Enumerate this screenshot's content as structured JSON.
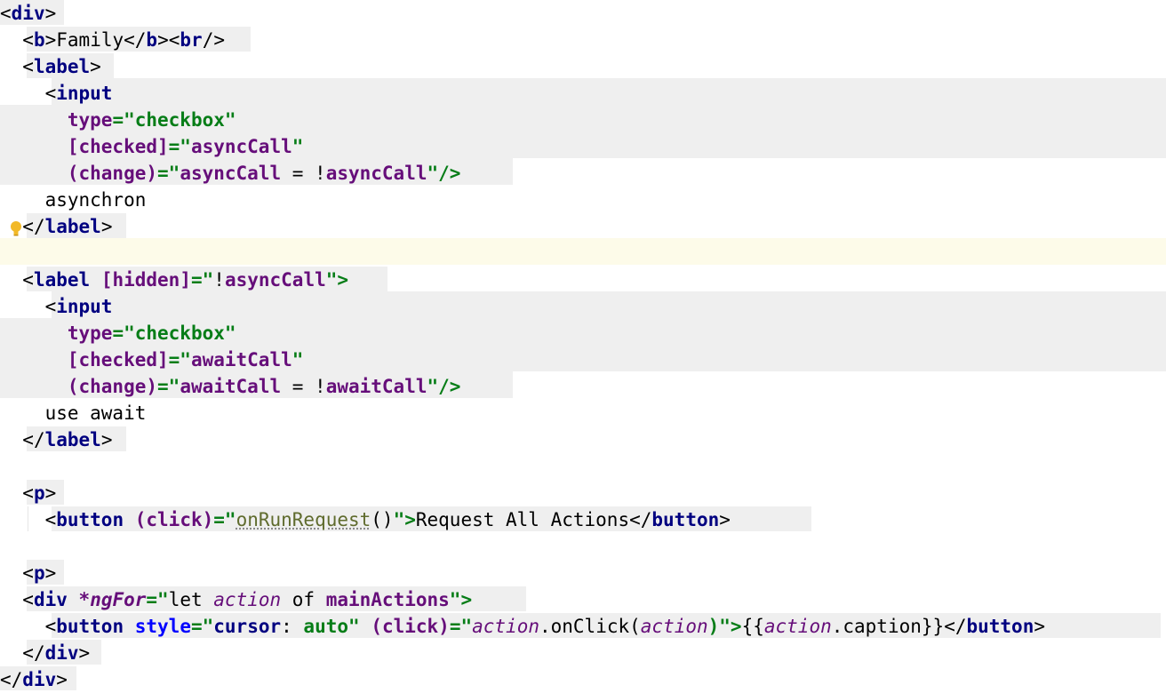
{
  "editor": {
    "language": "html-angular-template",
    "colors": {
      "tag": "#000080",
      "attribute": "#660e7a",
      "string": "#067d17",
      "variable": "#660e7a",
      "italic_var": "#660e7a",
      "function": "#5f6b2d",
      "highlight_block": "#efefef",
      "current_line": "#fdfbe9",
      "bulb": "#f2b928"
    },
    "icons": [
      "intention-bulb-icon"
    ]
  },
  "code": {
    "l1": {
      "open": "<",
      "tag": "div",
      "close": ">"
    },
    "l2": {
      "b_open": "<",
      "b": "b",
      "b_close": ">",
      "text": "Family",
      "eb_open": "</",
      "eb": "b",
      "eb_close": ">",
      "br_open": "<",
      "br": "br",
      "br_close": "/>"
    },
    "l3": {
      "open": "<",
      "tag": "label",
      "close": ">"
    },
    "l4": {
      "open": "<",
      "tag": "input"
    },
    "l5": {
      "attr": "type",
      "eq": "=\"",
      "val": "checkbox",
      "end": "\""
    },
    "l6": {
      "attr": "[checked]",
      "eq": "=\"",
      "val": "asyncCall",
      "end": "\""
    },
    "l7": {
      "attr": "(change)",
      "eq": "=\"",
      "var1": "asyncCall",
      "op": " = !",
      "var2": "asyncCall",
      "end": "\"/>"
    },
    "l8": {
      "text": "asynchron"
    },
    "l9": {
      "open": "</",
      "tag": "label",
      "close": ">"
    },
    "l11": {
      "open": "<",
      "tag": "label",
      "attr": "[hidden]",
      "eq": "=\"",
      "op": "!",
      "var": "asyncCall",
      "end": "\">"
    },
    "l12": {
      "open": "<",
      "tag": "input"
    },
    "l13": {
      "attr": "type",
      "eq": "=\"",
      "val": "checkbox",
      "end": "\""
    },
    "l14": {
      "attr": "[checked]",
      "eq": "=\"",
      "val": "awaitCall",
      "end": "\""
    },
    "l15": {
      "attr": "(change)",
      "eq": "=\"",
      "var1": "awaitCall",
      "op": " = !",
      "var2": "awaitCall",
      "end": "\"/>"
    },
    "l16": {
      "text": "use await"
    },
    "l17": {
      "open": "</",
      "tag": "label",
      "close": ">"
    },
    "l19": {
      "open": "<",
      "tag": "p",
      "close": ">"
    },
    "l20": {
      "open": "<",
      "tag": "button",
      "attr": "(click)",
      "eq": "=\"",
      "fn": "onRunRequest",
      "parens": "()",
      "end": "\">",
      "text": "Request All Actions",
      "c_open": "</",
      "c_tag": "button",
      "c_close": ">"
    },
    "l22": {
      "open": "<",
      "tag": "p",
      "close": ">"
    },
    "l23": {
      "open": "<",
      "tag": "div",
      "attr": "*ngFor",
      "eq": "=\"",
      "kw": "let ",
      "var": "action",
      "of": " of ",
      "list": "mainActions",
      "end": "\">"
    },
    "l24": {
      "open": "<",
      "tag": "button",
      "attr1": "style",
      "eq1": "=\"",
      "css_prop": "cursor",
      "css_colon": ": ",
      "css_val": "auto",
      "end1": "\"",
      "attr2": "(click)",
      "eq2": "=\"",
      "v1": "action",
      "dot1": ".onClick(",
      "v2": "action",
      "end2": ")\">",
      "interp_open": "{{",
      "v3": "action",
      "dot2": ".caption",
      "interp_close": "}}",
      "c_open": "</",
      "c_tag": "button",
      "c_close": ">"
    },
    "l25": {
      "open": "</",
      "tag": "div",
      "close": ">"
    },
    "l26": {
      "open": "</",
      "tag": "div",
      "close": ">"
    }
  }
}
